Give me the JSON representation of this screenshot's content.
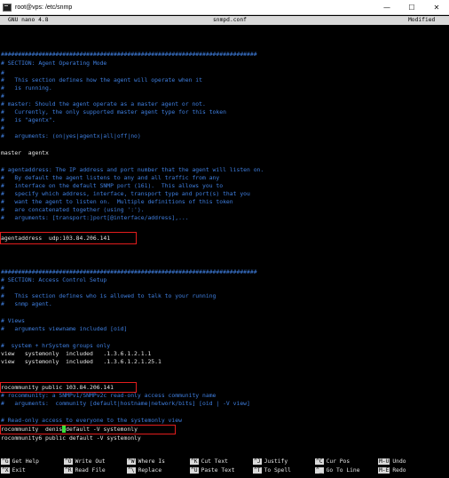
{
  "window": {
    "title": "root@vps: /etc/snmp",
    "app_icon": "terminal-icon",
    "controls": {
      "minimize": "—",
      "maximize": "☐",
      "close": "✕"
    }
  },
  "nano_header": {
    "version": "GNU nano 4.8",
    "filename": "snmpd.conf",
    "status": "Modified"
  },
  "colors": {
    "comment": "#3f7fe0",
    "text": "#e6e6e6",
    "background": "#000000",
    "highlight_box": "#e21d1d",
    "cursor": "#3be03b"
  },
  "lines": [
    "###########################################################################",
    "# SECTION: Agent Operating Mode",
    "#",
    "#   This section defines how the agent will operate when it",
    "#   is running.",
    "#",
    "# master: Should the agent operate as a master agent or not.",
    "#   Currently, the only supported master agent type for this token",
    "#   is \"agentx\".",
    "#",
    "#   arguments: (on|yes|agentx|all|off|no)",
    "master  agentx",
    "# agentaddress: The IP address and port number that the agent will listen on.",
    "#   By default the agent listens to any and all traffic from any",
    "#   interface on the default SNMP port (161).  This allows you to",
    "#   specify which address, interface, transport type and port(s) that you",
    "#   want the agent to listen on.  Multiple definitions of this token",
    "#   are concatenated together (using ':').",
    "#   arguments: [transport:]port[@interface/address],...",
    "agentaddress  udp:103.84.206.141",
    "###########################################################################",
    "# SECTION: Access Control Setup",
    "#",
    "#   This section defines who is allowed to talk to your running",
    "#   snmp agent.",
    "# Views",
    "#   arguments viewname included [oid]",
    "#  system + hrSystem groups only",
    "view   systemonly  included   .1.3.6.1.2.1.1",
    "view   systemonly  included   .1.3.6.1.2.1.25.1",
    "rocommunity public 103.84.206.141",
    "# rocommunity: a SNMPv1/SNMPv2c read-only access community name",
    "#   arguments:  community [default|hostname|network/bits] [oid | -V view]",
    "# Read-only access to everyone to the systemonly view",
    "rocommunity  denis",
    "default -V systemonly",
    "rocommunity6 public default -V systemonly"
  ],
  "shortcuts": [
    {
      "key": "^G",
      "label": "Get Help"
    },
    {
      "key": "^O",
      "label": "Write Out"
    },
    {
      "key": "^W",
      "label": "Where Is"
    },
    {
      "key": "^K",
      "label": "Cut Text"
    },
    {
      "key": "^J",
      "label": "Justify"
    },
    {
      "key": "^C",
      "label": "Cur Pos"
    },
    {
      "key": "M-U",
      "label": "Undo"
    },
    {
      "key": "^X",
      "label": "Exit"
    },
    {
      "key": "^R",
      "label": "Read File"
    },
    {
      "key": "^\\",
      "label": "Replace"
    },
    {
      "key": "^U",
      "label": "Paste Text"
    },
    {
      "key": "^T",
      "label": "To Spell"
    },
    {
      "key": "^_",
      "label": "Go To Line"
    },
    {
      "key": "M-E",
      "label": "Redo"
    }
  ]
}
